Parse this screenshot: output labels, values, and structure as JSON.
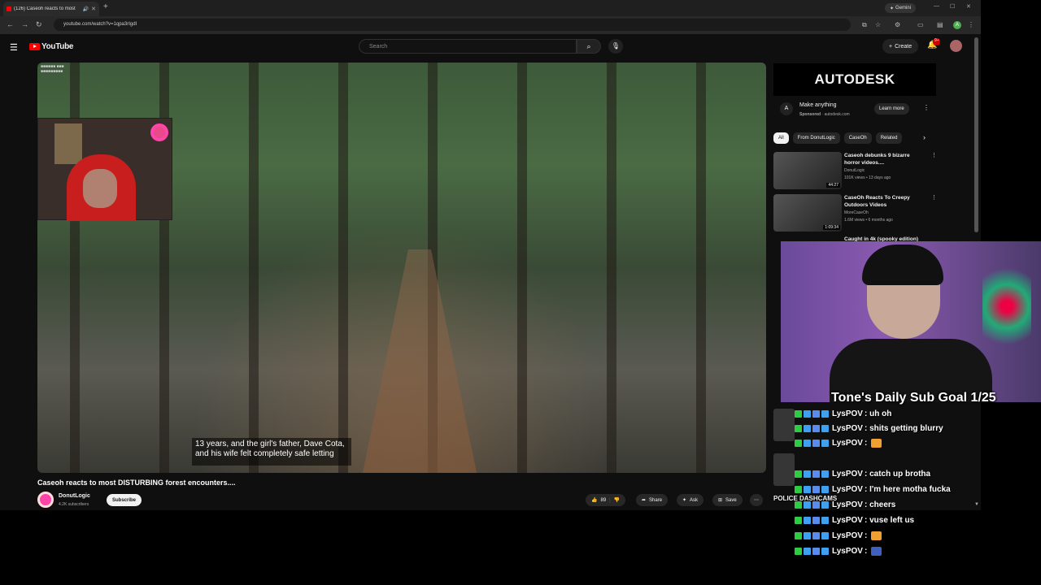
{
  "browser": {
    "tab_title": "(126) Caseoh reacts to most",
    "url": "youtube.com/watch?v=1qpa3rIgdI",
    "gemini_label": "Gemini",
    "profile_initial": "A"
  },
  "header": {
    "logo_text": "YouTube",
    "search_placeholder": "Search",
    "create_label": "Create",
    "notif_badge": "9+"
  },
  "video": {
    "title": "Caseoh reacts to most DISTURBING forest encounters....",
    "caption": "13 years, and the girl's father, Dave Cota, and his wife felt completely safe letting",
    "channel_name": "DonutLogic",
    "channel_subs": "4.2K subscribers",
    "subscribe_label": "Subscribe",
    "like_count": "89",
    "share_label": "Share",
    "ask_label": "Ask",
    "save_label": "Save"
  },
  "ad": {
    "banner": "AUTODESK",
    "title": "Make anything",
    "sponsored": "Sponsored",
    "domain": "autodesk.com",
    "learn_more": "Learn more"
  },
  "chips": [
    "All",
    "From DonutLogic",
    "CaseOh",
    "Related"
  ],
  "recommendations": [
    {
      "title": "Caseoh debunks 9 bizarre horror videos....",
      "channel": "DonutLogic",
      "meta": "101K views • 13 days ago",
      "duration": "44:27"
    },
    {
      "title": "CaseOh Reacts To Creepy Outdoors Videos",
      "channel": "MoreCaseOh",
      "meta": "1.6M views • 6 months ago",
      "duration": "1:09:34"
    }
  ],
  "rec_partial": "Caught in 4k (spooky edition)",
  "stream_overlay": {
    "goal_text": "Tone's Daily Sub Goal 1/25",
    "police_text": "POLICE DASHCAMS"
  },
  "chat": [
    {
      "user": "LysPOV",
      "text": ": uh oh"
    },
    {
      "user": "LysPOV",
      "text": ": shits getting blurry"
    },
    {
      "user": "LysPOV",
      "text": ":",
      "emote": "orange"
    },
    {
      "user": "LysPOV",
      "text": ": catch up brotha"
    },
    {
      "user": "LysPOV",
      "text": ": I'm here motha fucka"
    },
    {
      "user": "LysPOV",
      "text": ": cheers"
    },
    {
      "user": "LysPOV",
      "text": ": vuse left us"
    },
    {
      "user": "LysPOV",
      "text": ":",
      "emote": "orange"
    },
    {
      "user": "LysPOV",
      "text": ":",
      "emote": "blue"
    }
  ]
}
